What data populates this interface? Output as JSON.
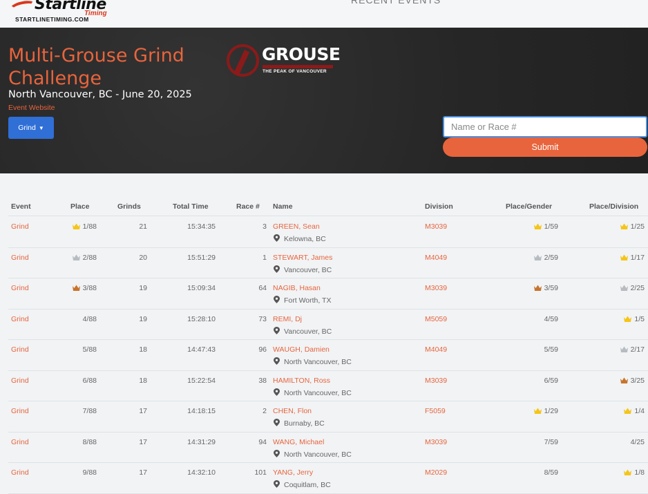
{
  "brand": {
    "name": "Startline",
    "sub": "Timing",
    "url": "STARTLINETIMING.COM"
  },
  "top_nav": "RECENT EVENTS",
  "event": {
    "title": "Multi-Grouse Grind Challenge",
    "subtitle": "North Vancouver, BC - June 20, 2025",
    "website_label": "Event Website",
    "select_label": "Grind",
    "sponsor_name": "GROUSE",
    "sponsor_sub": "MOUNTAIN",
    "sponsor_tag": "THE PEAK OF VANCOUVER"
  },
  "search": {
    "placeholder": "Name or Race #",
    "submit_label": "Submit"
  },
  "colors": {
    "accent": "#e8643c",
    "button_blue": "#2f6fd6",
    "gold": "#f5c518",
    "silver": "#b7bcc1",
    "bronze": "#c8742c"
  },
  "table": {
    "headers": [
      "Event",
      "Place",
      "Grinds",
      "Total Time",
      "Race #",
      "Name",
      "Division",
      "Place/Gender",
      "Place/Division"
    ],
    "rows": [
      {
        "event": "Grind",
        "place": "1/88",
        "place_medal": "gold",
        "grinds": "21",
        "time": "15:34:35",
        "race": "3",
        "name": "GREEN, Sean",
        "location": "Kelowna, BC",
        "division": "M3039",
        "place_gender": "1/59",
        "gender_medal": "gold",
        "place_division": "1/25",
        "division_medal": "gold"
      },
      {
        "event": "Grind",
        "place": "2/88",
        "place_medal": "silver",
        "grinds": "20",
        "time": "15:51:29",
        "race": "1",
        "name": "STEWART, James",
        "location": "Vancouver, BC",
        "division": "M4049",
        "place_gender": "2/59",
        "gender_medal": "silver",
        "place_division": "1/17",
        "division_medal": "gold"
      },
      {
        "event": "Grind",
        "place": "3/88",
        "place_medal": "bronze",
        "grinds": "19",
        "time": "15:09:34",
        "race": "64",
        "name": "NAGIB, Hasan",
        "location": "Fort Worth, TX",
        "division": "M3039",
        "place_gender": "3/59",
        "gender_medal": "bronze",
        "place_division": "2/25",
        "division_medal": "silver"
      },
      {
        "event": "Grind",
        "place": "4/88",
        "place_medal": "",
        "grinds": "19",
        "time": "15:28:10",
        "race": "73",
        "name": "REMI, Dj",
        "location": "Vancouver, BC",
        "division": "M5059",
        "place_gender": "4/59",
        "gender_medal": "",
        "place_division": "1/5",
        "division_medal": "gold"
      },
      {
        "event": "Grind",
        "place": "5/88",
        "place_medal": "",
        "grinds": "18",
        "time": "14:47:43",
        "race": "96",
        "name": "WAUGH, Damien",
        "location": "North Vancouver, BC",
        "division": "M4049",
        "place_gender": "5/59",
        "gender_medal": "",
        "place_division": "2/17",
        "division_medal": "silver"
      },
      {
        "event": "Grind",
        "place": "6/88",
        "place_medal": "",
        "grinds": "18",
        "time": "15:22:54",
        "race": "38",
        "name": "HAMILTON, Ross",
        "location": "North Vancouver, BC",
        "division": "M3039",
        "place_gender": "6/59",
        "gender_medal": "",
        "place_division": "3/25",
        "division_medal": "bronze"
      },
      {
        "event": "Grind",
        "place": "7/88",
        "place_medal": "",
        "grinds": "17",
        "time": "14:18:15",
        "race": "2",
        "name": "CHEN, Flon",
        "location": "Burnaby, BC",
        "division": "F5059",
        "place_gender": "1/29",
        "gender_medal": "gold",
        "place_division": "1/4",
        "division_medal": "gold"
      },
      {
        "event": "Grind",
        "place": "8/88",
        "place_medal": "",
        "grinds": "17",
        "time": "14:31:29",
        "race": "94",
        "name": "WANG, Michael",
        "location": "North Vancouver, BC",
        "division": "M3039",
        "place_gender": "7/59",
        "gender_medal": "",
        "place_division": "4/25",
        "division_medal": ""
      },
      {
        "event": "Grind",
        "place": "9/88",
        "place_medal": "",
        "grinds": "17",
        "time": "14:32:10",
        "race": "101",
        "name": "YANG, Jerry",
        "location": "Coquitlam, BC",
        "division": "M2029",
        "place_gender": "8/59",
        "gender_medal": "",
        "place_division": "1/8",
        "division_medal": "gold"
      }
    ]
  }
}
